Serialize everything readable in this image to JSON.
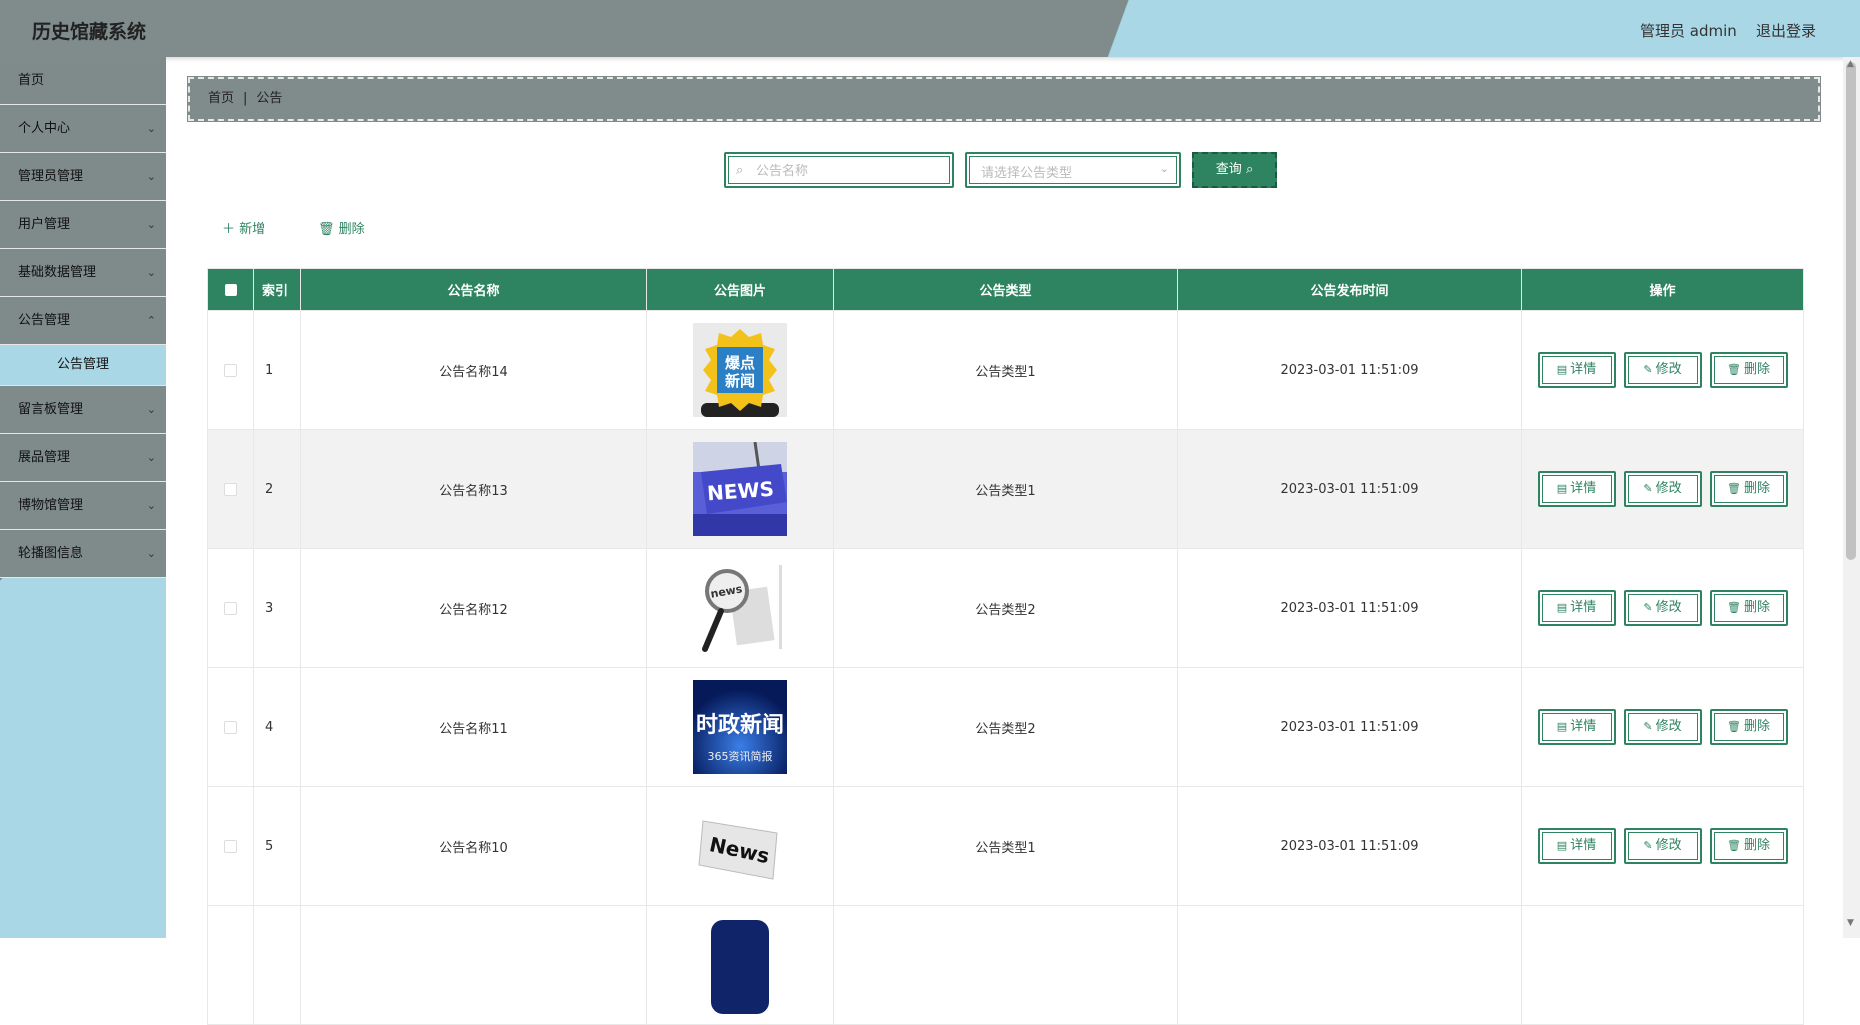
{
  "header": {
    "title": "历史馆藏系统",
    "user_label": "管理员 admin",
    "logout_label": "退出登录"
  },
  "sidebar": {
    "items": [
      {
        "label": "首页",
        "expandable": false
      },
      {
        "label": "个人中心",
        "expandable": true
      },
      {
        "label": "管理员管理",
        "expandable": true
      },
      {
        "label": "用户管理",
        "expandable": true
      },
      {
        "label": "基础数据管理",
        "expandable": true
      },
      {
        "label": "公告管理",
        "expandable": true
      },
      {
        "label": "留言板管理",
        "expandable": true
      },
      {
        "label": "展品管理",
        "expandable": true
      },
      {
        "label": "博物馆管理",
        "expandable": true
      },
      {
        "label": "轮播图信息",
        "expandable": true
      }
    ],
    "active_sub": "公告管理"
  },
  "breadcrumb": {
    "home": "首页",
    "separator": "|",
    "current": "公告"
  },
  "search": {
    "name_placeholder": "公告名称",
    "type_placeholder": "请选择公告类型",
    "query_label": "查询"
  },
  "actions": {
    "add_label": "新增",
    "delete_label": "删除"
  },
  "table": {
    "headers": {
      "index": "索引",
      "name": "公告名称",
      "image": "公告图片",
      "type": "公告类型",
      "time": "公告发布时间",
      "ops": "操作"
    },
    "rows": [
      {
        "index": "1",
        "name": "公告名称14",
        "image": "news-flash",
        "type": "公告类型1",
        "time": "2023-03-01 11:51:09"
      },
      {
        "index": "2",
        "name": "公告名称13",
        "image": "news-key",
        "type": "公告类型1",
        "time": "2023-03-01 11:51:09"
      },
      {
        "index": "3",
        "name": "公告名称12",
        "image": "magnifier-news",
        "type": "公告类型2",
        "time": "2023-03-01 11:51:09"
      },
      {
        "index": "4",
        "name": "公告名称11",
        "image": "political-news",
        "type": "公告类型2",
        "time": "2023-03-01 11:51:09"
      },
      {
        "index": "5",
        "name": "公告名称10",
        "image": "newspaper-news",
        "type": "公告类型1",
        "time": "2023-03-01 11:51:09"
      }
    ],
    "op_labels": {
      "detail": "详情",
      "edit": "修改",
      "delete": "删除"
    }
  },
  "thumb_text": {
    "flash_top": "爆点",
    "flash_bottom": "新闻",
    "key": "NEWS",
    "magnifier": "news",
    "political": "时政新闻",
    "political_sub": "365资讯简报",
    "paper": "News"
  },
  "colors": {
    "primary": "#2e8360",
    "header_gray": "#808b8c",
    "header_blue": "#a9d7e6"
  }
}
